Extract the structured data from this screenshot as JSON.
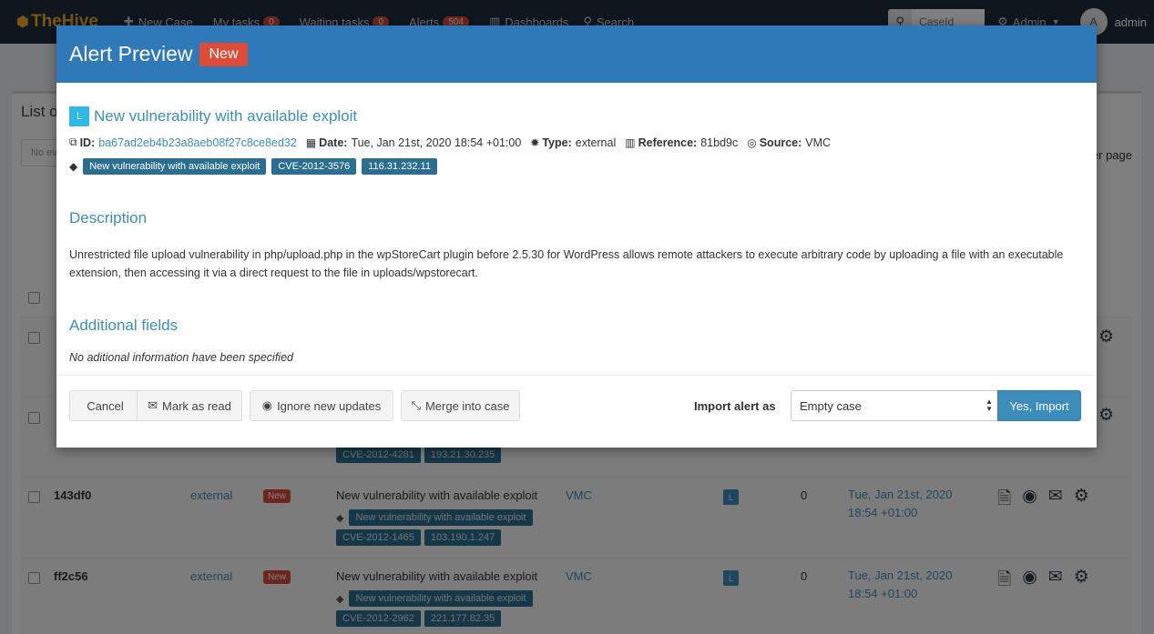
{
  "navbar": {
    "brand": "TheHive",
    "new_case": "New Case",
    "my_tasks": "My tasks",
    "my_tasks_count": "0",
    "waiting_tasks": "Waiting tasks",
    "waiting_tasks_count": "0",
    "alerts": "Alerts",
    "alerts_count": "504",
    "dashboards": "Dashboards",
    "search": "Search",
    "caseid_placeholder": "CaseId",
    "admin_menu": "Admin",
    "avatar_letter": "A",
    "user": "admin"
  },
  "list": {
    "title": "List o",
    "filter_placeholder": "No ev",
    "per_page": "er page",
    "rows": [
      {
        "ref": "143df0",
        "type": "external",
        "status": "New",
        "title": "New vulnerability with available exploit",
        "tags": [
          "New vulnerability with available exploit",
          "CVE-2012-1465",
          "103.190.1.247"
        ],
        "source": "VMC",
        "tlp": "L",
        "observables": "0",
        "date_line1": "Tue, Jan 21st, 2020",
        "date_line2": "18:54 +01:00"
      },
      {
        "ref": "ff2c56",
        "type": "external",
        "status": "New",
        "title": "New vulnerability with available exploit",
        "tags": [
          "New vulnerability with available exploit",
          "CVE-2012-2962",
          "221.177.82.35"
        ],
        "source": "VMC",
        "tlp": "L",
        "observables": "0",
        "date_line1": "Tue, Jan 21st, 2020",
        "date_line2": "18:54 +01:00"
      }
    ],
    "partial_row_tags": [
      "CVE-2012-4281",
      "193.21.30.235"
    ]
  },
  "modal": {
    "title": "Alert Preview",
    "badge": "New",
    "tlp": "L",
    "alert_title": "New vulnerability with available exploit",
    "id_label": "ID:",
    "id_value": "ba67ad2eb4b23a8aeb08f27c8ce8ed32",
    "date_label": "Date:",
    "date_value": "Tue, Jan 21st, 2020 18:54 +01:00",
    "type_label": "Type:",
    "type_value": "external",
    "reference_label": "Reference:",
    "reference_value": "81bd9c",
    "source_label": "Source:",
    "source_value": "VMC",
    "tags": [
      "New vulnerability with available exploit",
      "CVE-2012-3576",
      "116.31.232.11"
    ],
    "description_title": "Description",
    "description": "Unrestricted file upload vulnerability in php/upload.php in the wpStoreCart plugin before 2.5.30 for WordPress allows remote attackers to execute arbitrary code by uploading a file with an executable extension, then accessing it via a direct request to the file in uploads/wpstorecart.",
    "additional_title": "Additional fields",
    "no_info": "No aditional information have been specified",
    "buttons": {
      "cancel": "Cancel",
      "mark_read": "Mark as read",
      "ignore_updates": "Ignore new updates",
      "merge": "Merge into case",
      "import_label": "Import alert as",
      "import_option": "Empty case",
      "import_confirm": "Yes, Import"
    }
  },
  "colors": {
    "navbar": "#1f2d3d",
    "modal_header": "#2f79b9",
    "badge_red": "#dd4b39",
    "link_blue": "#3c8dbc",
    "tag_bg": "#2c6e8f"
  }
}
